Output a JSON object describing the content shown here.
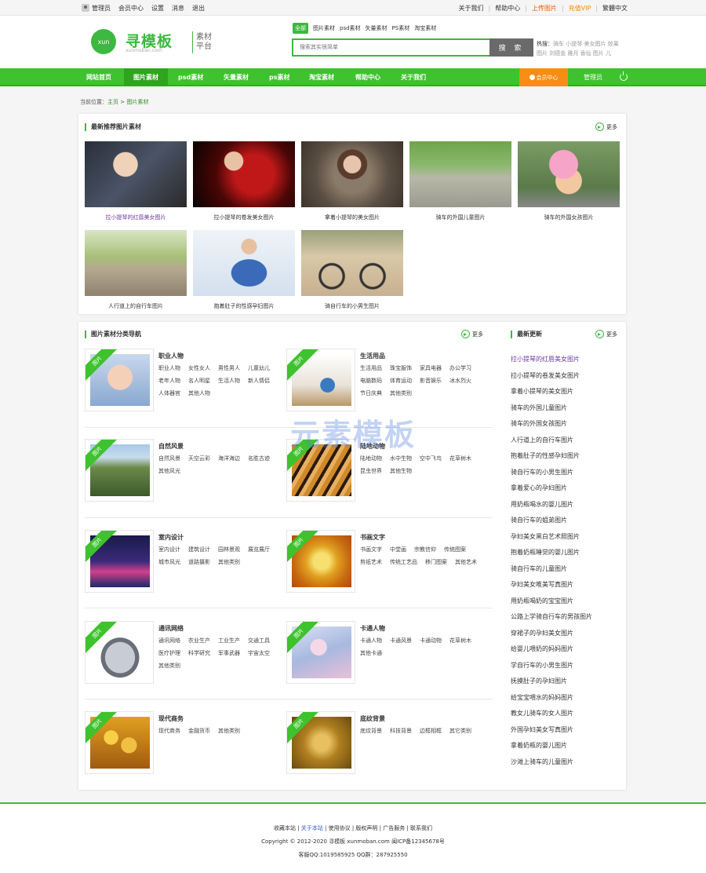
{
  "topbar": {
    "user": "管理员",
    "links": [
      "会员中心",
      "设置",
      "消息",
      "退出"
    ],
    "right": [
      "关于我们",
      "帮助中心",
      "上传图片",
      "充值VIP",
      "繁體中文"
    ]
  },
  "header": {
    "logo_icon_text": "xun",
    "logo_title": "寻模板",
    "logo_domain": "xunmoban.com",
    "logo_tag": "素材平台",
    "search_tabs": [
      "全部",
      "图片素材",
      "psd素材",
      "矢量素材",
      "PS素材",
      "淘宝素材"
    ],
    "search_placeholder": "搜索其实很简单",
    "search_button": "搜 索",
    "hot_label": "热搜：",
    "hot_words": "骑车 小提琴 美女图片 效果图片 刘德金 雅月 香仙 图片 儿"
  },
  "nav": {
    "items": [
      "网站首页",
      "图片素材",
      "psd素材",
      "矢量素材",
      "ps素材",
      "淘宝素材",
      "帮助中心",
      "关于我们"
    ],
    "member": "会员中心",
    "admin": "管理员"
  },
  "breadcrumb": {
    "prefix": "当前位置：",
    "home": "主页",
    "sep": ">",
    "current": "图片素材"
  },
  "recommend": {
    "title": "最新推荐图片素材",
    "more": "更多",
    "items": [
      "拉小提琴的红唇美女图片",
      "拉小提琴的卷发美女图片",
      "拿着小提琴的美女图片",
      "骑车的外国儿童图片",
      "骑车的外国女孩图片",
      "人行道上的自行车图片",
      "抱着肚子的性感孕妇图片",
      "骑自行车的小男生图片"
    ]
  },
  "categories": {
    "title": "图片素材分类导航",
    "more": "更多",
    "ribbon": "图片",
    "items": [
      {
        "name": "职业人物",
        "tags": [
          "职业人物",
          "女性女人",
          "男性男人",
          "儿童幼儿",
          "老年人物",
          "名人明星",
          "生活人物",
          "新人情侣",
          "人体器官",
          "其他人物"
        ]
      },
      {
        "name": "生活用品",
        "tags": [
          "生活用品",
          "珠宝服饰",
          "家具电器",
          "办公学习",
          "电脑数码",
          "体育运动",
          "影音娱乐",
          "冰水烈火",
          "节日庆典",
          "其他类别"
        ]
      },
      {
        "name": "自然风景",
        "tags": [
          "自然风景",
          "天空云彩",
          "海洋海边",
          "名胜古迹",
          "其他风光"
        ]
      },
      {
        "name": "陆地动物",
        "tags": [
          "陆地动物",
          "水中生物",
          "空中飞鸟",
          "花草树木",
          "昆虫世界",
          "其他生物"
        ]
      },
      {
        "name": "室内设计",
        "tags": [
          "室内设计",
          "建筑设计",
          "园林景观",
          "展览展厅",
          "城市风光",
          "道路摄影",
          "其他类别"
        ]
      },
      {
        "name": "书画文字",
        "tags": [
          "书画文字",
          "中堂画",
          "宗教信仰",
          "传统图案",
          "剪纸艺术",
          "传统工艺品",
          "移门图案",
          "其他艺术"
        ]
      },
      {
        "name": "通讯网络",
        "tags": [
          "通讯网络",
          "农业生产",
          "工业生产",
          "交通工具",
          "医疗护理",
          "科学研究",
          "军事武器",
          "宇宙太空",
          "其他类别"
        ]
      },
      {
        "name": "卡通人物",
        "tags": [
          "卡通人物",
          "卡通风景",
          "卡通动物",
          "花草树木",
          "其他卡通"
        ]
      },
      {
        "name": "现代商务",
        "tags": [
          "现代商务",
          "金融货币",
          "其他类别"
        ]
      },
      {
        "name": "底纹背景",
        "tags": [
          "底纹背景",
          "科技背景",
          "边框相框",
          "其它类别"
        ]
      }
    ]
  },
  "latest": {
    "title": "最新更新",
    "more": "更多",
    "items": [
      "拉小提琴的红唇美女图片",
      "拉小提琴的卷发美女图片",
      "拿着小提琴的美女图片",
      "骑车的外国儿童图片",
      "骑车的外国女孩图片",
      "人行道上的自行车图片",
      "抱着肚子的性感孕妇图片",
      "骑自行车的小男生图片",
      "拿着爱心的孕妇图片",
      "用奶瓶喝水的婴儿图片",
      "骑自行车的姐弟图片",
      "孕妇美女黑白艺术照图片",
      "抱着奶瓶睡觉的婴儿图片",
      "骑自行车的儿童图片",
      "孕妇美女唯美写真图片",
      "用奶瓶喝奶的宝宝图片",
      "公路上学骑自行车的男孩图片",
      "穿裙子的孕妇美女图片",
      "给婴儿喂奶的妈妈图片",
      "学自行车的小男生图片",
      "抚摸肚子的孕妇图片",
      "给宝宝喂水的妈妈图片",
      "教女儿骑车的女人图片",
      "外国孕妇美女写真图片",
      "拿着奶瓶的婴儿图片",
      "沙滩上骑车的儿童图片"
    ]
  },
  "watermark": "元素模板",
  "footer": {
    "links": [
      "收藏本站",
      "关于本站",
      "使用协议",
      "版权声明",
      "广告服务",
      "联系我们"
    ],
    "copyright": "Copyright © 2012-2020 寻模板 xunmoban.com 闽ICP备12345678号",
    "contact": "客服QQ:1019585925 QQ群：287925550"
  },
  "colors": {
    "brand_green": "#3ec22d",
    "member_orange": "#f78d14",
    "vip_orange": "#ff8800",
    "visited_purple": "#6b3aa0"
  }
}
